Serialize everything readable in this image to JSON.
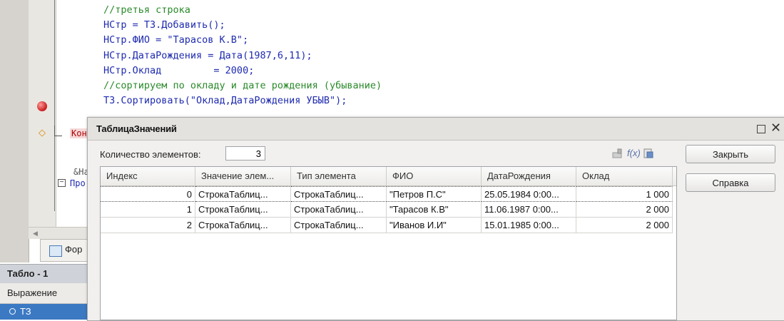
{
  "editor": {
    "code_lines": [
      {
        "text": "//третья строка",
        "comment": true
      },
      {
        "text": "НСтр = ТЗ.Добавить();",
        "comment": false
      },
      {
        "text": "НСтр.ФИО = \"Тарасов К.В\";",
        "comment": false
      },
      {
        "text": "НСтр.ДатаРождения = Дата(1987,6,11);",
        "comment": false
      },
      {
        "text": "НСтр.Оклад         = 2000;",
        "comment": false
      },
      {
        "text": "//сортируем по окладу и дате рождения (убывание)",
        "comment": true
      },
      {
        "text": "ТЗ.Сортировать(\"Оклад,ДатаРождения УБЫВ\");",
        "comment": false
      }
    ],
    "kon_fragment": "Кон",
    "amp_fragment": "&На",
    "proc_fragment": "Про",
    "form_tab_label": "Фор"
  },
  "tablo": {
    "title": "Табло - 1",
    "expression_label": "Выражение",
    "selected_item": "ТЗ"
  },
  "dialog": {
    "title": "ТаблицаЗначений",
    "count_label": "Количество элементов:",
    "count_value": "3",
    "buttons": {
      "close": "Закрыть",
      "help": "Справка"
    },
    "columns": [
      "Индекс",
      "Значение элем...",
      "Тип элемента",
      "ФИО",
      "ДатаРождения",
      "Оклад"
    ],
    "rows": [
      [
        "0",
        "СтрокаТаблиц...",
        "СтрокаТаблиц...",
        "\"Петров П.С\"",
        "25.05.1984 0:00...",
        "1 000"
      ],
      [
        "1",
        "СтрокаТаблиц...",
        "СтрокаТаблиц...",
        "\"Тарасов К.В\"",
        "11.06.1987 0:00...",
        "2 000"
      ],
      [
        "2",
        "СтрокаТаблиц...",
        "СтрокаТаблиц...",
        "\"Иванов И.И\"",
        "15.01.1985 0:00...",
        "2 000"
      ]
    ]
  },
  "icons": {
    "breakpoint": "breakpoint-icon",
    "current_line": "current-line-arrow-icon",
    "collapse": "collapse-minus-icon",
    "form": "form-icon",
    "window_maximize": "maximize-icon",
    "window_close": "close-icon"
  }
}
